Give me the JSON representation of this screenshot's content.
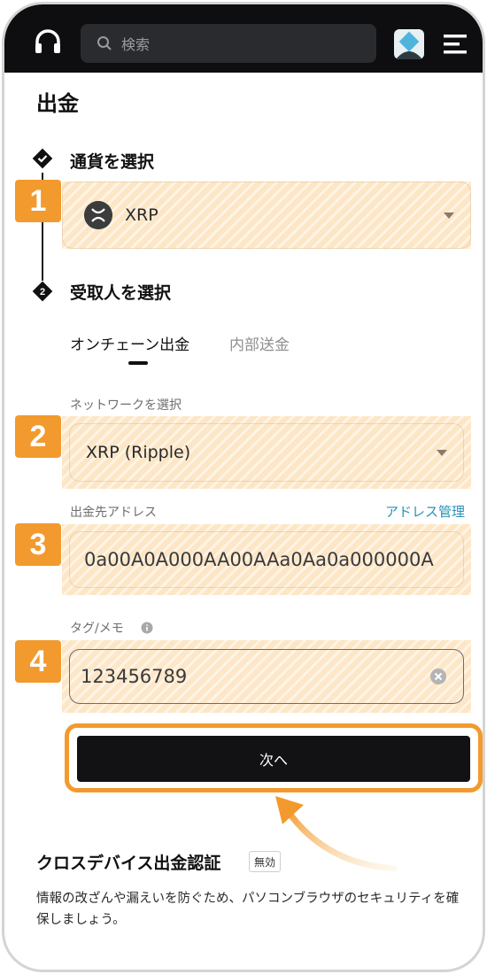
{
  "header": {
    "search_placeholder": "検索"
  },
  "page": {
    "title": "出金"
  },
  "step1": {
    "number": "1",
    "title": "通貨を選択",
    "currency": "XRP"
  },
  "step2": {
    "title": "受取人を選択",
    "tabs": [
      {
        "label": "オンチェーン出金",
        "active": true
      },
      {
        "label": "内部送金",
        "active": false
      }
    ]
  },
  "network": {
    "label": "ネットワークを選択",
    "value": "XRP (Ripple)"
  },
  "address": {
    "label": "出金先アドレス",
    "manage_link": "アドレス管理",
    "value": "0a00A0A000AA00AAa0Aa0a000000A"
  },
  "memo": {
    "label": "タグ/メモ",
    "value": "123456789"
  },
  "badges": [
    "1",
    "2",
    "3",
    "4"
  ],
  "next_button": "次へ",
  "cross_device": {
    "title": "クロスデバイス出金認証",
    "status": "無効",
    "description": "情報の改ざんや漏えいを防ぐため、パソコンブラウザのセキュリティを確保しましょう。"
  },
  "colors": {
    "accent_orange": "#f29a2e",
    "highlight": "#fde6c6",
    "link": "#2a8fb8",
    "header_bg": "#0e0e10"
  }
}
